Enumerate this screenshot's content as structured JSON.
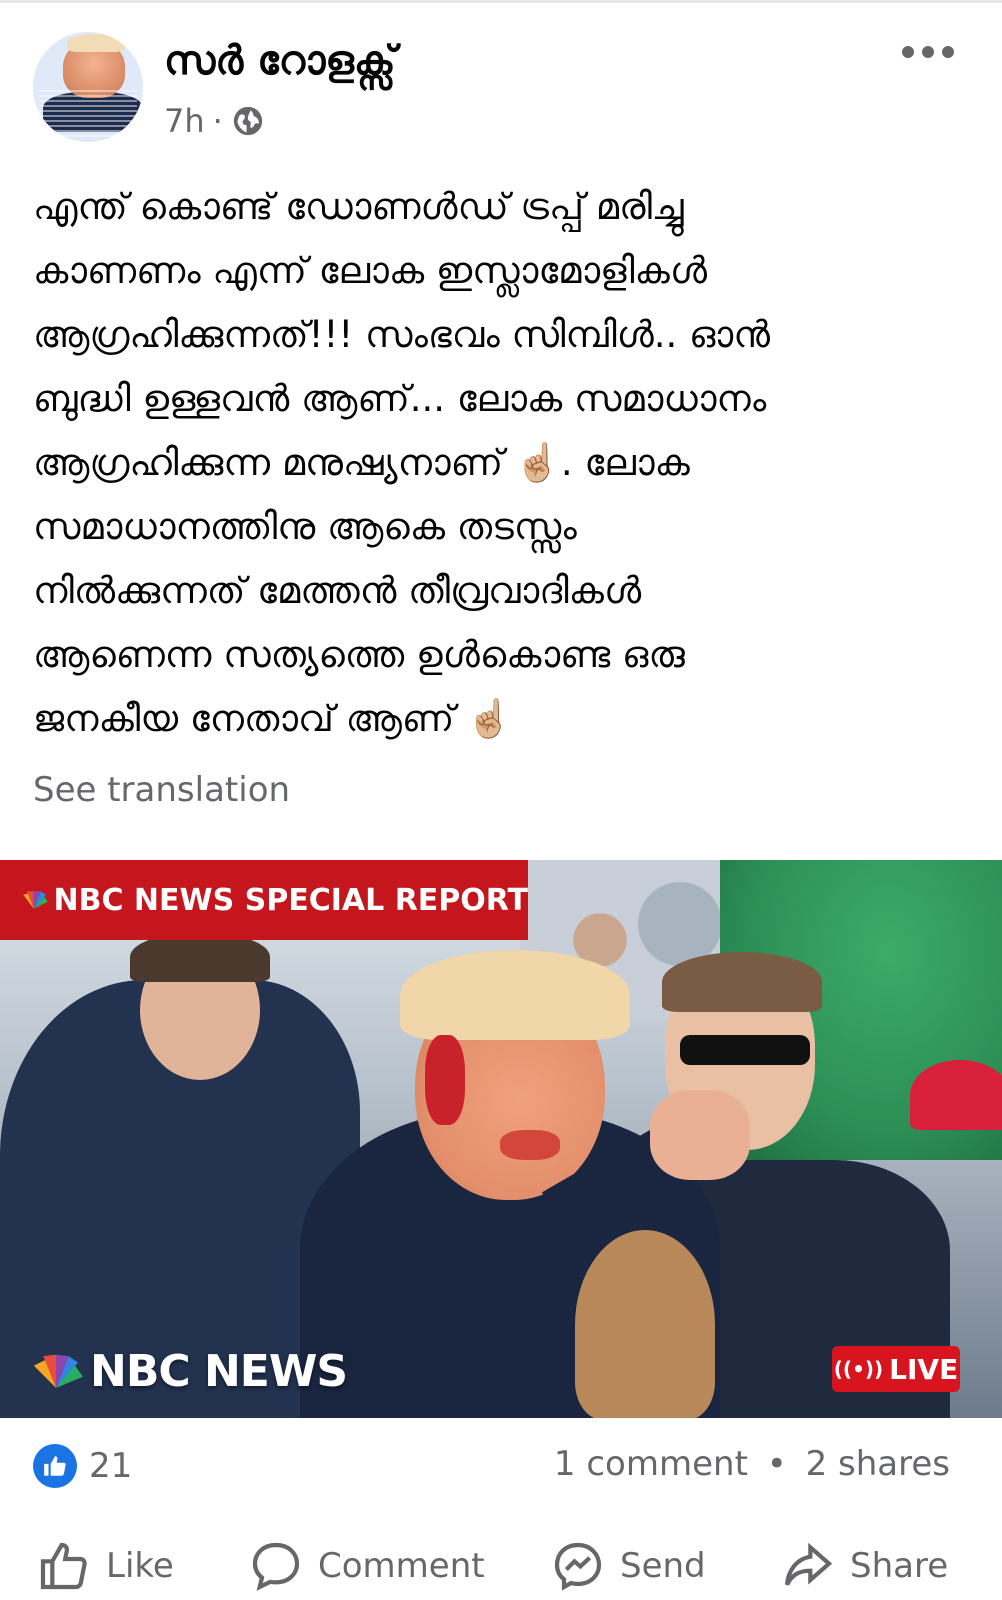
{
  "post": {
    "author": "സർ റോളക്സ്",
    "time": "7h",
    "time_separator": "·",
    "privacy_icon": "globe-icon",
    "text_lines": [
      "എന്ത് കൊണ്ട് ഡോണൾഡ് ട്രപ്പ് മരിച്ചു",
      "കാണണം എന്ന് ലോക ഇസ്ലാമോളികൾ",
      "ആഗ്രഹിക്കുന്നത്!!! സംഭവം സിമ്പിൾ.. ഓൻ",
      "ബുദ്ധി ഉള്ളവൻ ആണ്... ലോക സമാധാനം",
      "ആഗ്രഹിക്കുന്ന മനുഷ്യനാണ് ☝🏼. ലോക",
      "സമാധാനത്തിനു ആകെ തടസ്സം",
      "നിൽക്കുന്നത് മേത്തൻ തീവ്രവാദികൾ",
      "ആണെന്ന സത്യത്തെ ഉൾകൊണ്ട ഒരു",
      "ജനകീയ നേതാവ് ആണ് ☝🏼"
    ],
    "see_translation": "See translation"
  },
  "media": {
    "banner_text": "NBC NEWS SPECIAL REPORT",
    "logo_text": "NBC NEWS",
    "live_text": "LIVE",
    "live_icon": "((•))"
  },
  "stats": {
    "reactions_count": "21",
    "comments": "1 comment",
    "separator": "•",
    "shares": "2 shares"
  },
  "actions": {
    "like": "Like",
    "comment": "Comment",
    "send": "Send",
    "share": "Share"
  },
  "colors": {
    "facebook_blue": "#1b74e4",
    "secondary_text": "#65676b",
    "nbc_red": "#c4161c"
  }
}
